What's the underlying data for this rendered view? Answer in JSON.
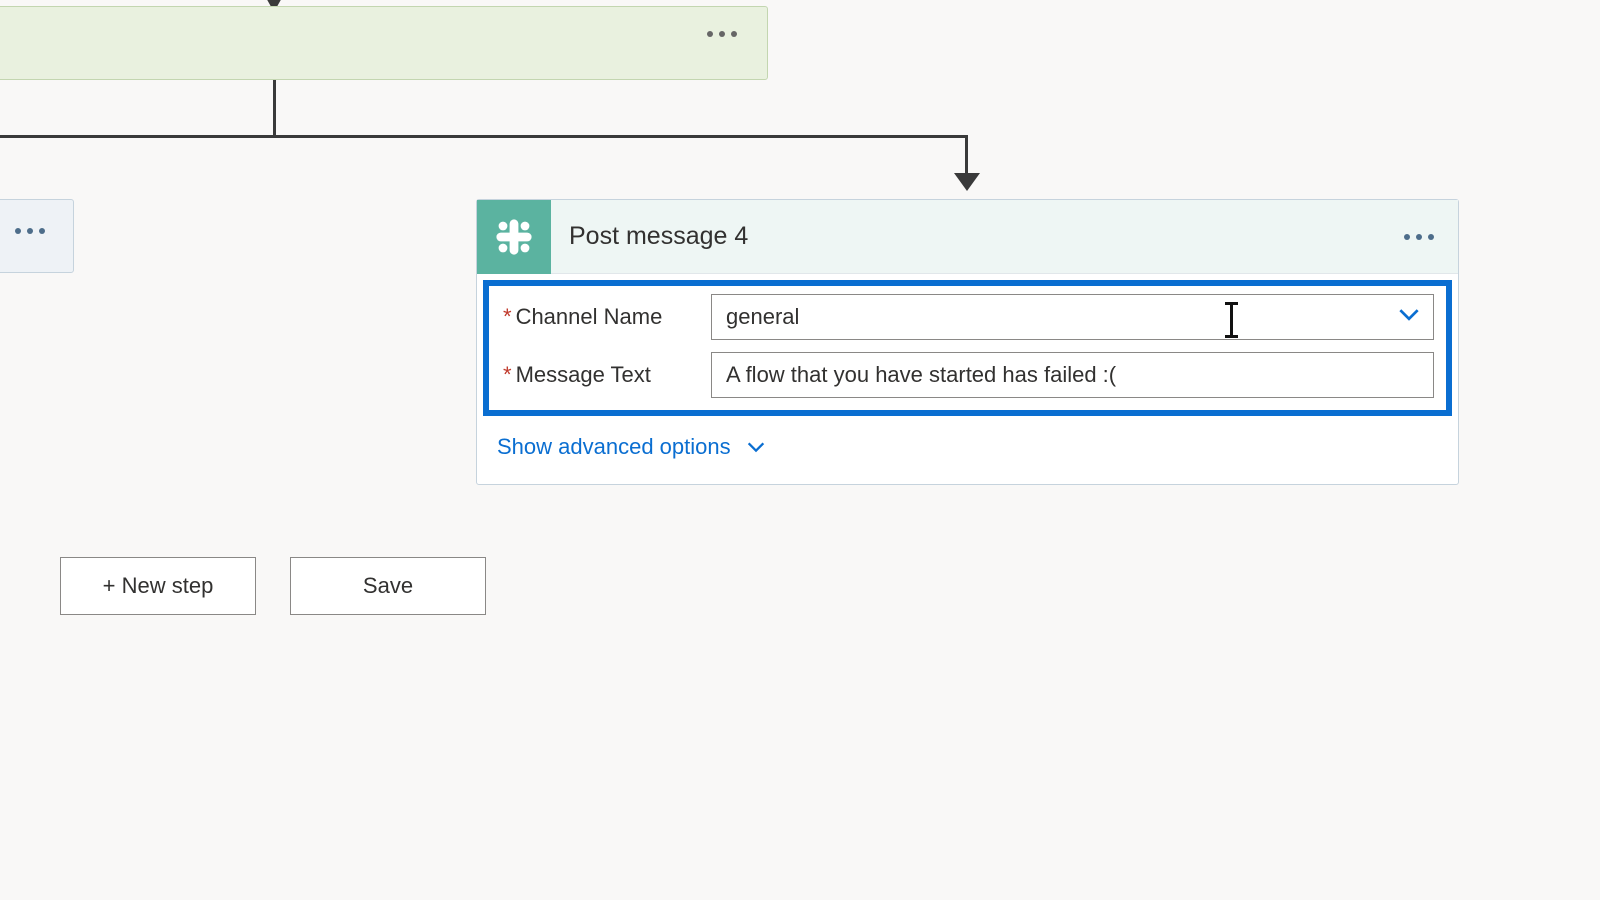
{
  "action": {
    "title": "Post message 4",
    "fields": {
      "channel": {
        "label": "Channel Name",
        "value": "general"
      },
      "message": {
        "label": "Message Text",
        "value": "A flow that you have started has failed :("
      }
    },
    "advanced": "Show advanced options"
  },
  "buttons": {
    "newstep": "+ New step",
    "save": "Save"
  }
}
